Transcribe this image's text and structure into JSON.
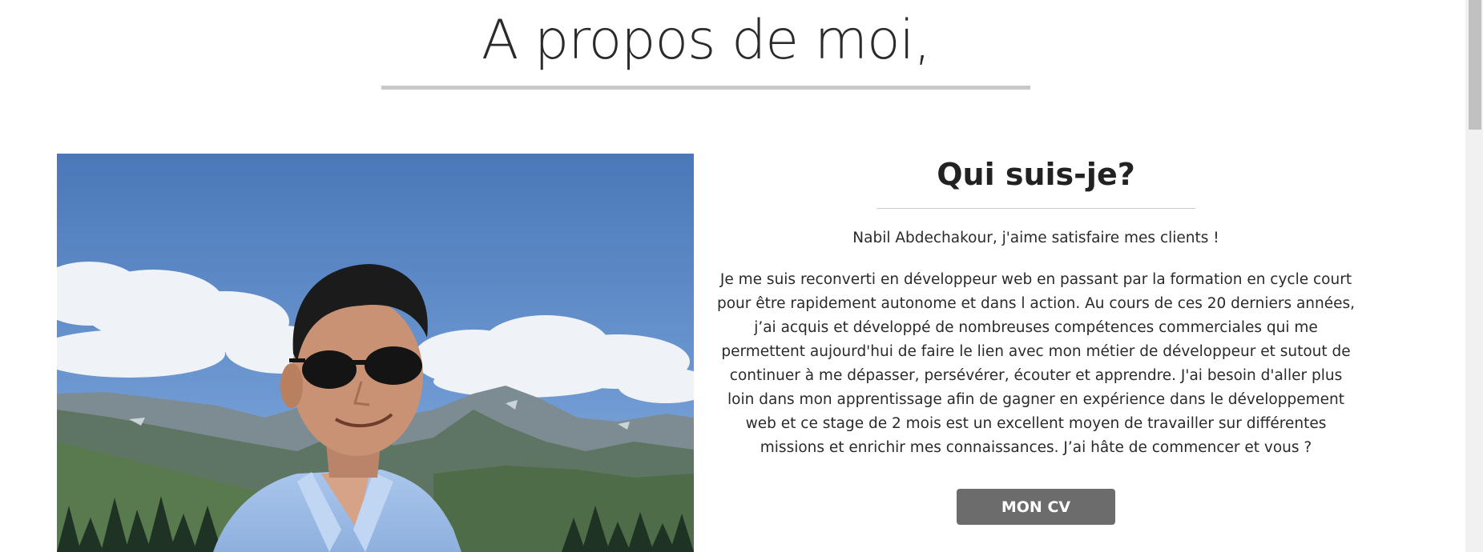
{
  "page": {
    "title": "A propos de moi,"
  },
  "photo": {
    "alt": "Nabil Abdechakour"
  },
  "about": {
    "heading": "Qui suis-je?",
    "tagline": "Nabil Abdechakour, j'aime satisfaire mes clients !",
    "bio": "Je me suis reconverti en développeur web en passant par la formation en cycle court pour être rapidement autonome et dans l action. Au cours de ces 20 derniers années, j’ai acquis et développé de nombreuses compétences commerciales qui me permettent aujourd'hui de faire le lien avec mon métier de développeur et sutout de continuer à me dépasser, persévérer, écouter et apprendre. J'ai besoin d'aller plus loin dans mon apprentissage afin de gagner en expérience dans le développement web et ce stage de 2 mois est un excellent moyen de travailler sur différentes missions et enrichir mes connaissances. J’ai hâte de commencer et vous ?",
    "cv_button_label": "MON CV"
  },
  "colors": {
    "title_rule": "#c8c8c8",
    "button_bg": "#6c6c6c",
    "button_text": "#ffffff",
    "sky": "#4f7fbf"
  }
}
